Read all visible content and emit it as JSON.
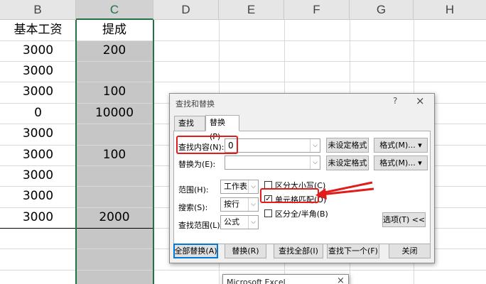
{
  "sheet": {
    "columns": [
      "B",
      "C",
      "D",
      "E",
      "F",
      "G",
      "H"
    ],
    "header_row": {
      "b": "基本工资",
      "c": "提成"
    },
    "rows": [
      {
        "b": "3000",
        "c": "200"
      },
      {
        "b": "3000",
        "c": ""
      },
      {
        "b": "3000",
        "c": "100"
      },
      {
        "b": "0",
        "c": "10000"
      },
      {
        "b": "3000",
        "c": ""
      },
      {
        "b": "3000",
        "c": "100"
      },
      {
        "b": "3000",
        "c": ""
      },
      {
        "b": "3000",
        "c": ""
      },
      {
        "b": "3000",
        "c": "2000"
      }
    ],
    "selected_column": "C"
  },
  "dialog": {
    "title": "查找和替换",
    "help": "?",
    "close": "×",
    "tabs": [
      "查找(D)",
      "替换(P)"
    ],
    "active_tab": "替换(P)",
    "find_label": "查找内容(N):",
    "find_value": "0",
    "replace_label": "替换为(E):",
    "replace_value": "",
    "no_format_label": "未设定格式",
    "format_label": "格式(M)...",
    "scope_label": "范围(H):",
    "scope_value": "工作表",
    "search_label": "搜索(S):",
    "search_value": "按行",
    "look_in_label": "查找范围(L):",
    "look_in_value": "公式",
    "match_case_label": "区分大小写(C)",
    "match_case_checked": false,
    "match_cell_label": "单元格匹配(O)",
    "match_cell_checked": true,
    "match_width_label": "区分全/半角(B)",
    "match_width_checked": false,
    "options_label": "选项(T) <<",
    "buttons": {
      "replace_all": "全部替换(A)",
      "replace": "替换(R)",
      "find_all": "查找全部(I)",
      "find_next": "查找下一个(F)",
      "close": "关闭"
    }
  },
  "msgbox": {
    "title": "Microsoft Excel",
    "close": "×"
  },
  "accent": {
    "highlight_red": "#e21b1b",
    "excel_green": "#217346"
  }
}
